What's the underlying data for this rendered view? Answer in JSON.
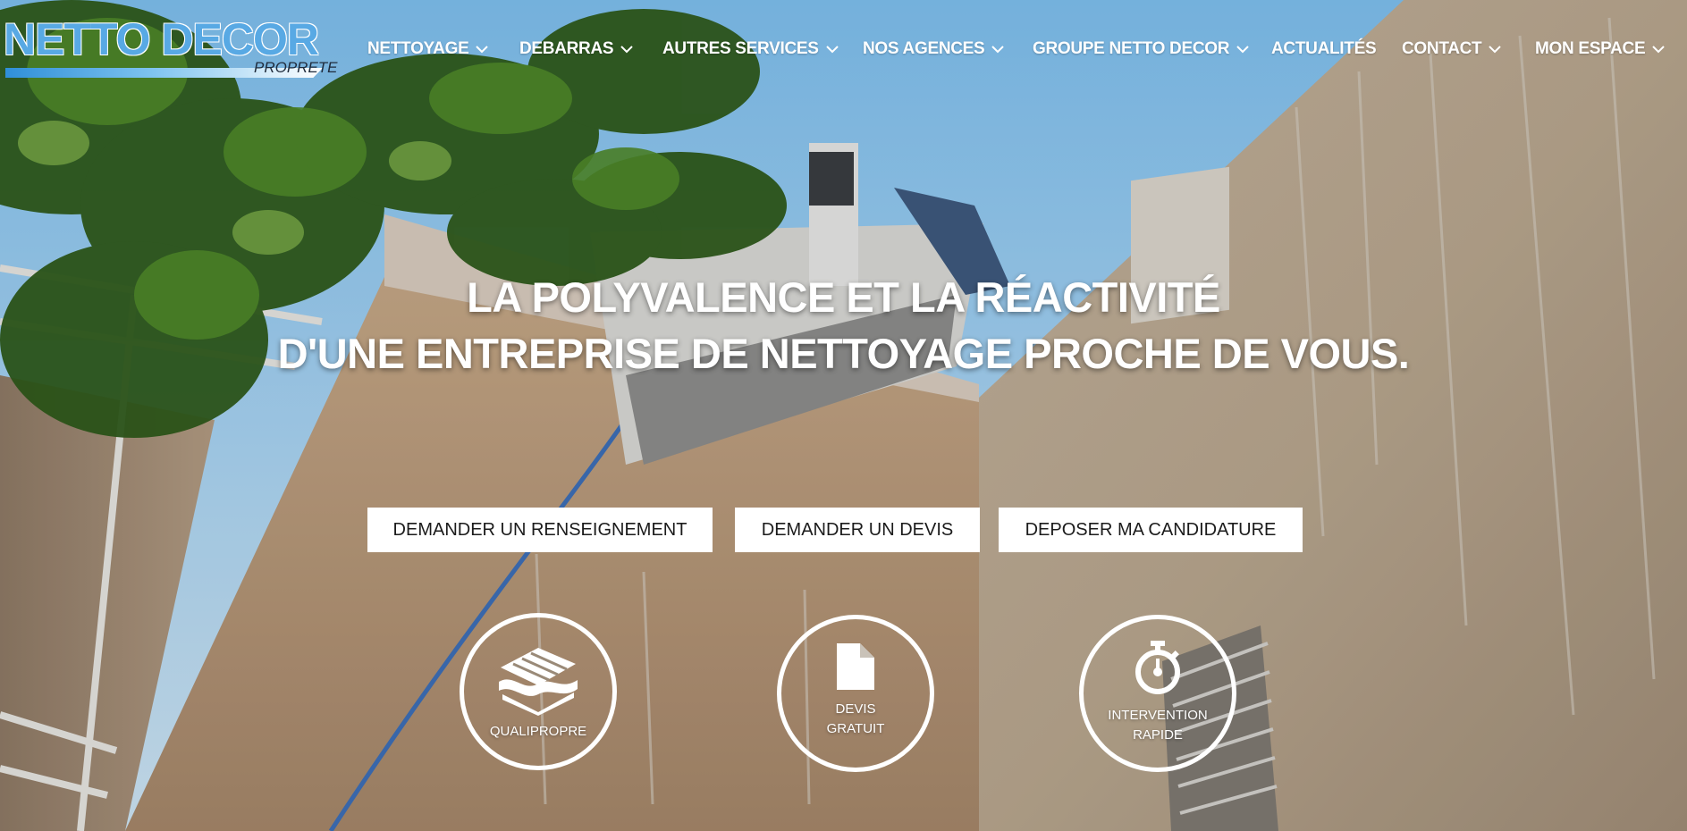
{
  "brand": {
    "name": "NETTO DECOR",
    "tagline": "PROPRETE"
  },
  "nav": {
    "items": [
      {
        "label": "NETTOYAGE",
        "dropdown": true
      },
      {
        "label": "DEBARRAS",
        "dropdown": true
      },
      {
        "label": "AUTRES SERVICES",
        "dropdown": true
      },
      {
        "label": "NOS AGENCES",
        "dropdown": true
      },
      {
        "label": "GROUPE NETTO DECOR",
        "dropdown": true
      },
      {
        "label": "ACTUALITÉS",
        "dropdown": false
      },
      {
        "label": "CONTACT",
        "dropdown": true
      },
      {
        "label": "MON ESPACE",
        "dropdown": true
      }
    ]
  },
  "hero": {
    "line1": "LA POLYVALENCE ET LA RÉACTIVITÉ",
    "line2": "D'UNE ENTREPRISE DE NETTOYAGE PROCHE DE VOUS."
  },
  "cta": {
    "info_label": "DEMANDER UN RENSEIGNEMENT",
    "quote_label": "DEMANDER UN DEVIS",
    "apply_label": "DEPOSER MA CANDIDATURE"
  },
  "features": {
    "qualipropre": {
      "label": "QUALIPROPRE",
      "icon": "qualipropre-logo-icon"
    },
    "devis": {
      "line1": "DEVIS",
      "line2": "GRATUIT",
      "icon": "document-icon"
    },
    "intervention": {
      "line1": "INTERVENTION",
      "line2": "RAPIDE",
      "icon": "stopwatch-icon"
    }
  },
  "colors": {
    "brand_blue": "#58a9e4",
    "button_bg": "#ffffff",
    "text_white": "#ffffff"
  }
}
